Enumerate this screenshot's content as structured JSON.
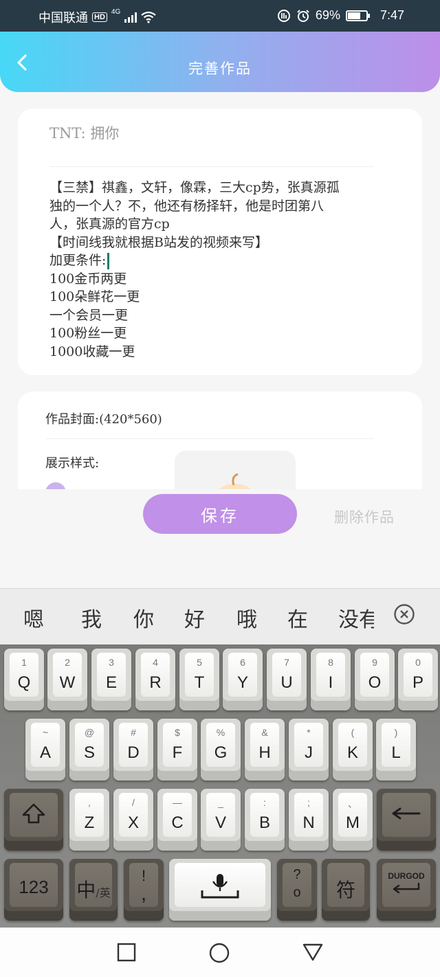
{
  "status_bar": {
    "carrier": "中国联通",
    "hd": "HD",
    "network": "4G",
    "battery": "69%",
    "time": "7:47"
  },
  "header": {
    "title": "完善作品"
  },
  "work": {
    "title": "TNT: 拥你",
    "body_lines": [
      "【三禁】祺鑫，文轩，像霖，三大cp势，张真源孤",
      "独的一个人？不，他还有杨择轩，他是时团第八",
      "人，张真源的官方cp",
      "【时间线我就根据B站发的视频来写】",
      "加更条件:",
      "100金币两更",
      "100朵鲜花一更",
      "一个会员一更",
      "100粉丝一更",
      "1000收藏一更"
    ]
  },
  "cover": {
    "label": "作品封面:(420*560)",
    "style_label": "展示样式:"
  },
  "actions": {
    "save": "保存",
    "delete": "删除作品"
  },
  "keyboard": {
    "candidates": [
      "嗯",
      "我",
      "你",
      "好",
      "哦",
      "在",
      "没有"
    ],
    "row1": [
      {
        "num": "1",
        "letter": "Q"
      },
      {
        "num": "2",
        "letter": "W"
      },
      {
        "num": "3",
        "letter": "E"
      },
      {
        "num": "4",
        "letter": "R"
      },
      {
        "num": "5",
        "letter": "T"
      },
      {
        "num": "6",
        "letter": "Y"
      },
      {
        "num": "7",
        "letter": "U"
      },
      {
        "num": "8",
        "letter": "I"
      },
      {
        "num": "9",
        "letter": "O"
      },
      {
        "num": "0",
        "letter": "P"
      }
    ],
    "row2": [
      {
        "num": "~",
        "letter": "A"
      },
      {
        "num": "@",
        "letter": "S"
      },
      {
        "num": "#",
        "letter": "D"
      },
      {
        "num": "$",
        "letter": "F"
      },
      {
        "num": "%",
        "letter": "G"
      },
      {
        "num": "&",
        "letter": "H"
      },
      {
        "num": "*",
        "letter": "J"
      },
      {
        "num": "(",
        "letter": "K"
      },
      {
        "num": ")",
        "letter": "L"
      }
    ],
    "row3": [
      {
        "num": ",",
        "letter": "Z"
      },
      {
        "num": "/",
        "letter": "X"
      },
      {
        "num": "—",
        "letter": "C"
      },
      {
        "num": "_",
        "letter": "V"
      },
      {
        "num": ":",
        "letter": "B"
      },
      {
        "num": ";",
        "letter": "N"
      },
      {
        "num": "、",
        "letter": "M"
      }
    ],
    "key_123": "123",
    "key_lang_main": "中",
    "key_lang_sub": "/英",
    "key_punct_top": "!",
    "key_punct_bottom": ",",
    "key_qmark_top": "?",
    "key_qmark_bottom": "o",
    "key_symbol": "符",
    "key_enter": "DURGOD"
  }
}
